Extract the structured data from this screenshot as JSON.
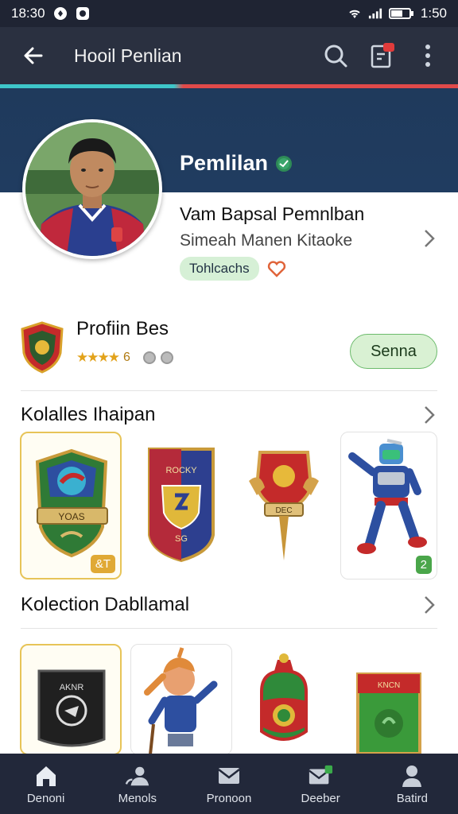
{
  "status_bar": {
    "time_left": "18:30",
    "time_right": "1:50"
  },
  "app_bar": {
    "title": "Hooil Penlian"
  },
  "banner": {
    "name": "Pemlilan"
  },
  "profile": {
    "name": "Vam Bapsal Pemnlban",
    "subtitle": "Simeah Manen Kitaoke",
    "tag": "Tohlcachs"
  },
  "best": {
    "title": "Profiin Bes",
    "rating_value": "6",
    "send_label": "Senna"
  },
  "section1": {
    "title": "Kolalles Ihaipan",
    "cards": [
      {
        "label": "YOAS",
        "badge": "&T"
      },
      {
        "label": "ROCKY",
        "sub": "SG"
      },
      {
        "label": "DEC"
      },
      {
        "badge": "2"
      }
    ]
  },
  "section2": {
    "title": "Kolection Dabllamal",
    "cards": [
      {
        "label": "AKNR"
      },
      {},
      {},
      {
        "label": "KNCN"
      }
    ]
  },
  "bottom_nav": {
    "items": [
      {
        "label": "Denoni"
      },
      {
        "label": "Menols"
      },
      {
        "label": "Pronoon"
      },
      {
        "label": "Deeber"
      },
      {
        "label": "Batird"
      }
    ]
  },
  "colors": {
    "accent_teal": "#3ec6c9",
    "accent_red": "#e04a4a",
    "nav_bg": "#22283a",
    "banner_bg": "#1f3a5c"
  }
}
